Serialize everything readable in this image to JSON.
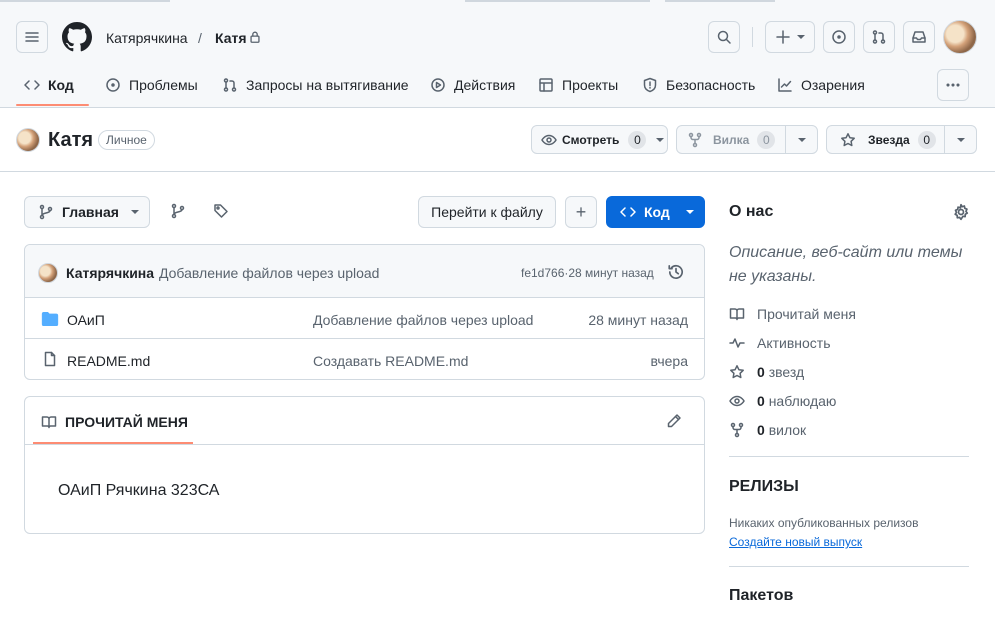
{
  "header": {
    "owner": "Катярячкина",
    "separator": "/",
    "repo": "Катя"
  },
  "tabs": [
    {
      "label": "Код"
    },
    {
      "label": "Проблемы"
    },
    {
      "label": "Запросы на вытягивание"
    },
    {
      "label": "Действия"
    },
    {
      "label": "Проекты"
    },
    {
      "label": "Безопасность"
    },
    {
      "label": "Озарения"
    }
  ],
  "repo_bar": {
    "name": "Катя",
    "visibility": "Личное",
    "watch_label": "Смотреть",
    "watch_count": "0",
    "fork_label": "Вилка",
    "fork_count": "0",
    "star_label": "Звезда",
    "star_count": "0"
  },
  "toolbar": {
    "branch": "Главная",
    "goto_file": "Перейти к файлу",
    "add": "+",
    "code": "Код"
  },
  "commit": {
    "author": "Катярячкина",
    "message": "Добавление файлов через upload",
    "hash_time": "fe1d766·28 минут назад"
  },
  "files": [
    {
      "name": "ОАиП",
      "type": "folder",
      "message": "Добавление файлов через upload",
      "time": "28 минут назад"
    },
    {
      "name": "README.md",
      "type": "file",
      "message": "Создавать README.md",
      "time": "вчера"
    }
  ],
  "readme": {
    "header": "ПРОЧИТАЙ МЕНЯ",
    "content": "ОАиП Рячкина 323СА"
  },
  "sidebar": {
    "about_title": "О нас",
    "description": "Описание, веб-сайт или темы не указаны.",
    "readme_link": "Прочитай меня",
    "activity_link": "Активность",
    "stars_count": "0",
    "stars_label": "звезд",
    "watching_count": "0",
    "watching_label": "наблюдаю",
    "forks_count": "0",
    "forks_label": "вилок",
    "releases_title": "РЕЛИЗЫ",
    "releases_empty": "Никаких опубликованных релизов",
    "create_release": "Создайте новый выпуск",
    "packages_title": "Пакетов"
  },
  "colors": {
    "accent_blue": "#0969da",
    "tab_underline": "#fd8c73",
    "folder": "#54aeff"
  }
}
